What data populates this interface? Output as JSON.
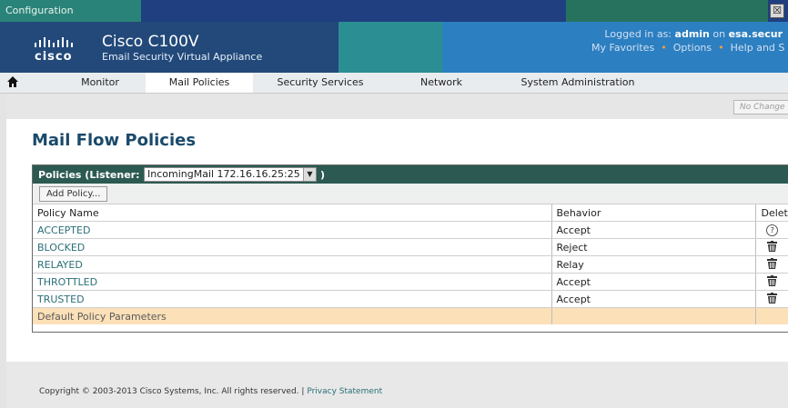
{
  "window": {
    "title": "Configuration",
    "close_glyph": "☒"
  },
  "header": {
    "logo_word": "cisco",
    "product_name": "Cisco C100V",
    "product_subtitle": "Email Security Virtual Appliance",
    "login_prefix": "Logged in as:",
    "login_user": "admin",
    "login_on": "on",
    "login_host": "esa.secur",
    "links": [
      "My Favorites",
      "Options",
      "Help and S"
    ],
    "link_separator": "•"
  },
  "nav": {
    "home_icon": "home-icon",
    "tabs": [
      "Monitor",
      "Mail Policies",
      "Security Services",
      "Network",
      "System Administration"
    ],
    "active_tab": "Mail Policies"
  },
  "commit_button": "No Change",
  "page_title": "Mail Flow Policies",
  "policies": {
    "header_label": "Policies (Listener:",
    "header_close": ")",
    "listener_value": "IncomingMail 172.16.16.25:25",
    "add_button": "Add Policy...",
    "columns": [
      "Policy Name",
      "Behavior",
      "Delete"
    ],
    "rows": [
      {
        "name": "ACCEPTED",
        "behavior": "Accept",
        "delete_icon": "help-icon",
        "delete_glyph": "?"
      },
      {
        "name": "BLOCKED",
        "behavior": "Reject",
        "delete_icon": "trash-icon"
      },
      {
        "name": "RELAYED",
        "behavior": "Relay",
        "delete_icon": "trash-icon"
      },
      {
        "name": "THROTTLED",
        "behavior": "Accept",
        "delete_icon": "trash-icon"
      },
      {
        "name": "TRUSTED",
        "behavior": "Accept",
        "delete_icon": "trash-icon"
      }
    ],
    "default_row": "Default Policy Parameters"
  },
  "footer": {
    "copyright": "Copyright © 2003-2013 Cisco Systems, Inc. All rights reserved.",
    "separator": "|",
    "privacy_link": "Privacy Statement"
  },
  "colors": {
    "title_bar": "#1f3f80",
    "banner": "#22497a",
    "panel_header": "#2c5a52",
    "link": "#2a6f76",
    "default_row": "#fce0b8"
  }
}
